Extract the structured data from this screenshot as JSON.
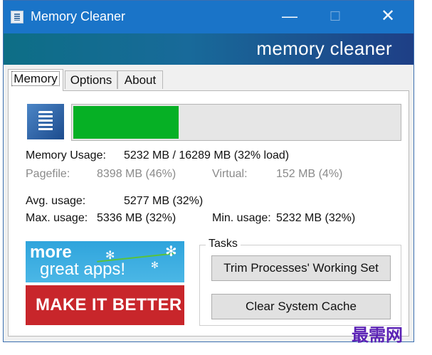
{
  "window": {
    "title": "Memory Cleaner",
    "minimize": "—",
    "maximize": "☐",
    "close": "✕"
  },
  "banner": {
    "text": "memory cleaner"
  },
  "tabs": [
    {
      "label": "Memory"
    },
    {
      "label": "Options"
    },
    {
      "label": "About"
    }
  ],
  "memory": {
    "load_fraction": 0.32,
    "usage_label": "Memory Usage:",
    "usage_value": "5232 MB / 16289 MB  (32% load)",
    "pagefile_label": "Pagefile:",
    "pagefile_value": "8398 MB (46%)",
    "virtual_label": "Virtual:",
    "virtual_value": "152 MB (4%)",
    "avg_label": "Avg. usage:",
    "avg_value": "5277 MB (32%)",
    "max_label": "Max. usage:",
    "max_value": "5336 MB (32%)",
    "min_label": "Min. usage:",
    "min_value": "5232 MB (32%)"
  },
  "ads": {
    "top_line1": "more",
    "top_line2": "great apps!",
    "bottom": "MAKE IT BETTER"
  },
  "tasks": {
    "label": "Tasks",
    "trim_button": "Trim Processes' Working Set",
    "clear_button": "Clear System Cache"
  },
  "watermark": "最需网",
  "colors": {
    "titlebar": "#1a74c8",
    "progress": "#06b025",
    "ad_red": "#c8262b",
    "ad_blue": "#2fa4dc"
  }
}
